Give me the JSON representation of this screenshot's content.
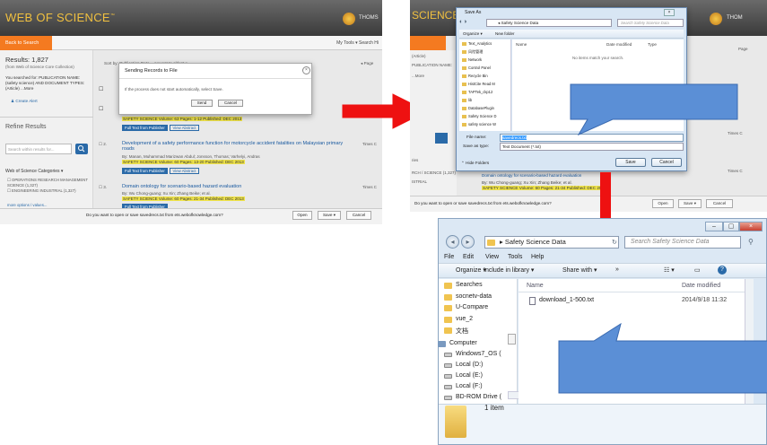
{
  "wos": {
    "brand": "WEB OF SCIENCE",
    "tm": "™",
    "partner": "THOMS",
    "back": "Back to Search",
    "nav_right": "My Tools ▾   Search Hi",
    "results": "Results: 1,827",
    "results_sub": "(from Web of Science Core Collection)",
    "search_desc": "You searched for: PUBLICATION NAME: (safety science) AND DOCUMENT TYPES: (Article) ...More",
    "create_alert": "Create Alert",
    "refine": "Refine Results",
    "refine_placeholder": "Search within results for...",
    "categories": "Web of Science Categories",
    "cat1": "OPERATIONS RESEARCH MANAGEMENT SCIENCE (1,327)",
    "cat2": "ENGINEERING INDUSTRIAL (1,327)",
    "more": "more options / values...",
    "sort": "Sort by:  Publication Date -- newest to oldest ▾",
    "page": "◂  Page",
    "times_cited": "Times C",
    "rec1_meta": "SAFETY SCIENCE  Volume: 63   Pages: 1-12   Published: DEC 2013",
    "rec2_num": "2.",
    "rec2_title": "Development of a safety performance function for motorcycle accident fatalities on Malaysian primary roads",
    "rec2_authors": "By: Manan, Muhammad Marizwan Abdul; Jonsson, Thomas; Varhelyi, Andras",
    "rec2_meta": "SAFETY SCIENCE  Volume: 60   Pages: 13-20   Published: DEC 2013",
    "rec3_num": "3.",
    "rec3_title": "Domain ontology for scenario-based hazard evaluation",
    "rec3_authors": "By: Wu Chong-guang; Xu Xin; Zhang Beike; et al.",
    "rec3_meta": "SAFETY SCIENCE  Volume: 60   Pages: 21-34   Published: DEC 2013",
    "ftp": "Full Text from Publisher",
    "view_abstract": "View Abstract",
    "dialog_title": "Sending Records to File",
    "dialog_msg": "If the process does not start automatically, select Save.",
    "dialog_save": "Send",
    "dialog_cancel": "Cancel",
    "dl_text": "Do you want to open or save savedrecs.txt from ets.webofknowledge.com?",
    "dl_open": "Open",
    "dl_save": "Save ▾",
    "dl_cancel": "Cancel"
  },
  "saveas": {
    "brand": "SCIENCE",
    "partner": "THOM",
    "title": "Save As",
    "address": "◂ Safety Science Data",
    "search": "Search Safety Science Data",
    "organize": "Organize ▾",
    "newfolder": "New folder",
    "nav": [
      "Text_Analytics",
      "风险管理",
      "Network",
      "Control Panel",
      "Recycle Bin",
      "HistCite Read M",
      "TAPTek_ckp12",
      "lib",
      "DatabasePlugin",
      "Safety Science D",
      "safety science W"
    ],
    "col_name": "Name",
    "col_date": "Date modified",
    "col_type": "Type",
    "empty": "No items match your search.",
    "filename_label": "File name:",
    "filename": "savedrecs.txt",
    "savetype_label": "Save as type:",
    "savetype": "Text Document (*.txt)",
    "hide": "Hide Folders",
    "save": "Save",
    "cancel": "Cancel",
    "side1": "(Article)",
    "side2": "PUBLICATION NAME:",
    "side3": "...More",
    "side4": "ries",
    "side5": "RCH / SCIENCE (1,327)",
    "side6": "ISTRIAL",
    "rec_title": "Domain ontology for scenario-based hazard evaluation",
    "rec_authors": "By: Wu Chong-guang; Xu Xin; Zhang Beike; et al.",
    "rec_meta": "SAFETY SCIENCE  Volume: 60   Pages: 21-34   Published: DEC 2013",
    "right1": "Page",
    "right2": "Times C",
    "dl_text": "Do you want to open or save savedrecs.txt from ets.webofknowledge.com?",
    "dl_open": "Open",
    "dl_save": "Save ▾",
    "dl_cancel": "Cancel"
  },
  "explorer": {
    "address": "▸  Safety Science Data",
    "search": "Search Safety Science Data",
    "menu": [
      "File",
      "Edit",
      "View",
      "Tools",
      "Help"
    ],
    "organize": "Organize ▾",
    "include": "Include in library ▾",
    "share": "Share with ▾",
    "more": "»",
    "nav": [
      "Searches",
      "socnetv-data",
      "U-Compare",
      "vue_2",
      "文档"
    ],
    "computer": "Computer",
    "drives": [
      "Windows7_OS (",
      "Local (D:)",
      "Local (E:)",
      "Local (F:)",
      "BD-ROM Drive ("
    ],
    "col_name": "Name",
    "col_date": "Date modified",
    "file_name": "download_1-500.txt",
    "file_date": "2014/9/18 11:32",
    "count": "1 item"
  }
}
